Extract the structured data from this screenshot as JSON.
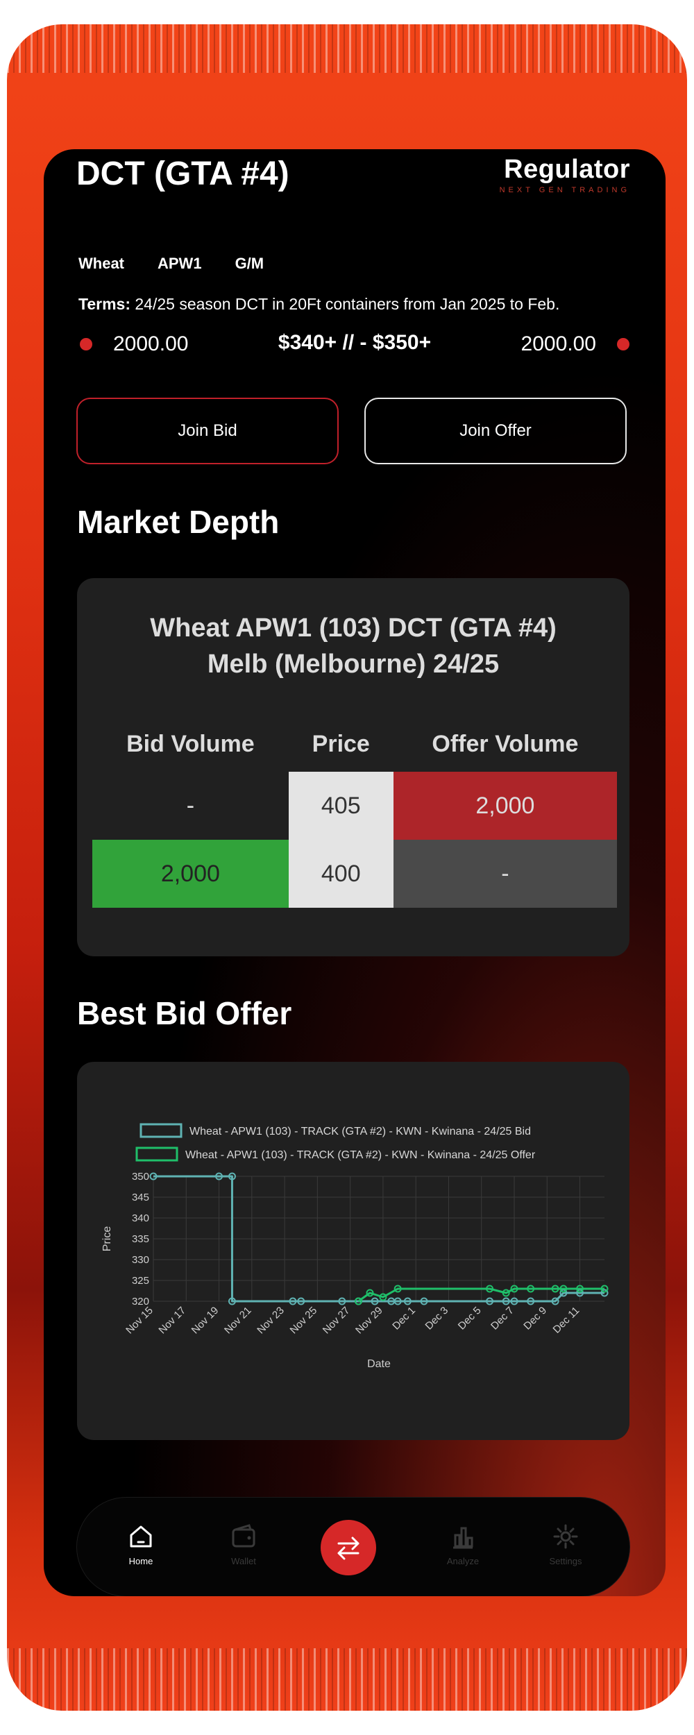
{
  "header": {
    "title": "DCT (GTA #4)",
    "brand": "Regulator",
    "brand_tagline": "NEXT GEN TRADING"
  },
  "tags": [
    "Wheat",
    "APW1",
    "G/M"
  ],
  "terms": {
    "label": "Terms:",
    "text": " 24/25 season DCT in 20Ft containers from Jan 2025 to Feb."
  },
  "quote": {
    "bid_volume": "2000.00",
    "spread": "$340+ // - $350+",
    "offer_volume": "2000.00"
  },
  "buttons": {
    "join_bid": "Join Bid",
    "join_offer": "Join Offer"
  },
  "market_depth": {
    "section_title": "Market Depth",
    "card_title_line1": "Wheat APW1 (103) DCT (GTA #4)",
    "card_title_line2": "Melb (Melbourne) 24/25",
    "headers": [
      "Bid Volume",
      "Price",
      "Offer Volume"
    ],
    "rows": [
      {
        "bid": "-",
        "price": "405",
        "offer": "2,000"
      },
      {
        "bid": "2,000",
        "price": "400",
        "offer": "-"
      }
    ]
  },
  "best_bid_offer": {
    "section_title": "Best Bid Offer"
  },
  "chart_data": {
    "type": "line",
    "xlabel": "Date",
    "ylabel": "Price",
    "ylim": [
      320,
      350
    ],
    "yticks": [
      350,
      345,
      340,
      335,
      330,
      325,
      320
    ],
    "xticks": [
      "Nov 15",
      "Nov 17",
      "Nov 19",
      "Nov 21",
      "Nov 23",
      "Nov 25",
      "Nov 27",
      "Nov 29",
      "Dec 1",
      "Dec 3",
      "Dec 5",
      "Dec 7",
      "Dec 9",
      "Dec 11"
    ],
    "grid": true,
    "legend_position": "top",
    "series": [
      {
        "name": "Wheat - APW1 (103) - TRACK (GTA #2) - KWN - Kwinana - 24/25 Bid",
        "color": "#5fb3b3",
        "x": [
          0,
          4,
          4.8,
          4.8,
          8.5,
          9.0,
          11.5,
          12.5,
          13.5,
          14.5,
          14.9,
          15.5,
          16.5,
          20.5,
          21.5,
          22.0,
          23.0,
          24.5,
          25.0,
          26.0,
          27.5
        ],
        "y": [
          350,
          350,
          350,
          320,
          320,
          320,
          320,
          320,
          320,
          320,
          320,
          320,
          320,
          320,
          320,
          320,
          320,
          320,
          322,
          322,
          322
        ]
      },
      {
        "name": "Wheat - APW1 (103) - TRACK (GTA #2) - KWN - Kwinana - 24/25 Offer",
        "color": "#1fbf6a",
        "x": [
          12.5,
          13.2,
          14.0,
          14.9,
          20.5,
          21.5,
          22.0,
          23.0,
          24.5,
          25.0,
          26.0,
          27.5
        ],
        "y": [
          320,
          322,
          321,
          323,
          323,
          322,
          323,
          323,
          323,
          323,
          323,
          323
        ]
      }
    ]
  },
  "nav": {
    "items": [
      "Home",
      "Wallet",
      "Analyze",
      "Settings"
    ]
  },
  "colors": {
    "accent": "#d62828",
    "bid_green": "#31a33a",
    "offer_red": "#ad2529"
  }
}
